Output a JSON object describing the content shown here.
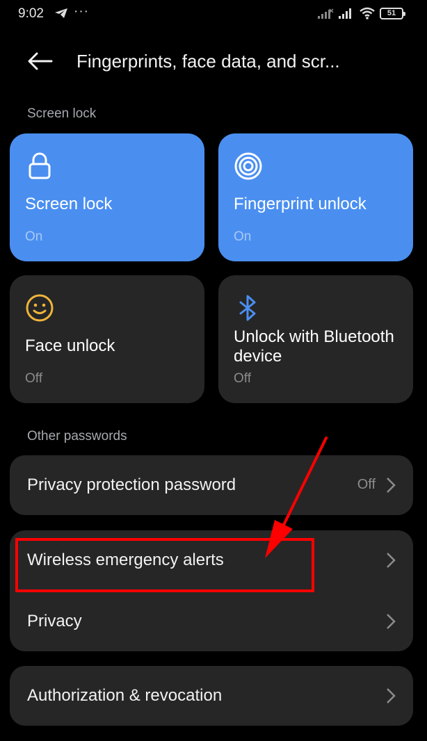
{
  "status_bar": {
    "time": "9:02",
    "dots": "···",
    "battery": "51",
    "icons": [
      "telegram-icon",
      "signal-icon",
      "signal-icon",
      "wifi-icon",
      "battery-icon"
    ]
  },
  "header": {
    "title": "Fingerprints, face data, and scr..."
  },
  "sections": {
    "screen_lock": "Screen lock",
    "other_passwords": "Other passwords"
  },
  "tiles": [
    {
      "label": "Screen lock",
      "status": "On",
      "icon": "lock-icon"
    },
    {
      "label": "Fingerprint unlock",
      "status": "On",
      "icon": "fingerprint-icon"
    },
    {
      "label": "Face unlock",
      "status": "Off",
      "icon": "smiley-face-icon"
    },
    {
      "label": "Unlock with Bluetooth device",
      "status": "Off",
      "icon": "bluetooth-icon"
    }
  ],
  "rows": {
    "privacy_password": {
      "label": "Privacy protection password",
      "value": "Off"
    },
    "wireless_alerts": {
      "label": "Wireless emergency alerts"
    },
    "privacy": {
      "label": "Privacy"
    },
    "authorization": {
      "label": "Authorization & revocation"
    }
  },
  "colors": {
    "accent": "#4a8ff0",
    "tile_bg": "#262626",
    "annotation": "#ff0000"
  }
}
